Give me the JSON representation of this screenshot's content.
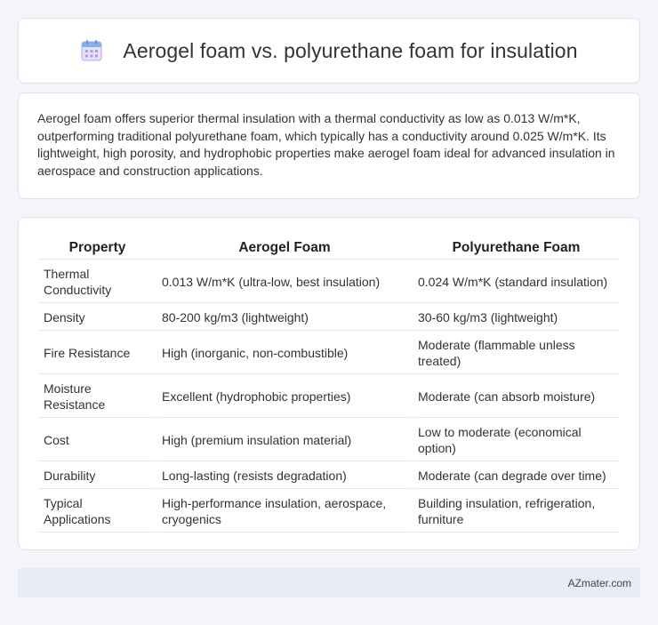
{
  "header": {
    "title": "Aerogel foam vs. polyurethane foam for insulation",
    "icon": "calendar-icon"
  },
  "intro": {
    "text": "Aerogel foam offers superior thermal insulation with a thermal conductivity as low as 0.013 W/m*K, outperforming traditional polyurethane foam, which typically has a conductivity around 0.025 W/m*K. Its lightweight, high porosity, and hydrophobic properties make aerogel foam ideal for advanced insulation in aerospace and construction applications."
  },
  "table": {
    "headers": [
      "Property",
      "Aerogel Foam",
      "Polyurethane Foam"
    ],
    "rows": [
      [
        "Thermal Conductivity",
        "0.013 W/m*K (ultra-low, best insulation)",
        "0.024 W/m*K (standard insulation)"
      ],
      [
        "Density",
        "80-200 kg/m3 (lightweight)",
        "30-60 kg/m3 (lightweight)"
      ],
      [
        "Fire Resistance",
        "High (inorganic, non-combustible)",
        "Moderate (flammable unless treated)"
      ],
      [
        "Moisture Resistance",
        "Excellent (hydrophobic properties)",
        "Moderate (can absorb moisture)"
      ],
      [
        "Cost",
        "High (premium insulation material)",
        "Low to moderate (economical option)"
      ],
      [
        "Durability",
        "Long-lasting (resists degradation)",
        "Moderate (can degrade over time)"
      ],
      [
        "Typical Applications",
        "High-performance insulation, aerospace, cryogenics",
        "Building insulation, refrigeration, furniture"
      ]
    ]
  },
  "footer": {
    "text": "AZmater.com"
  }
}
